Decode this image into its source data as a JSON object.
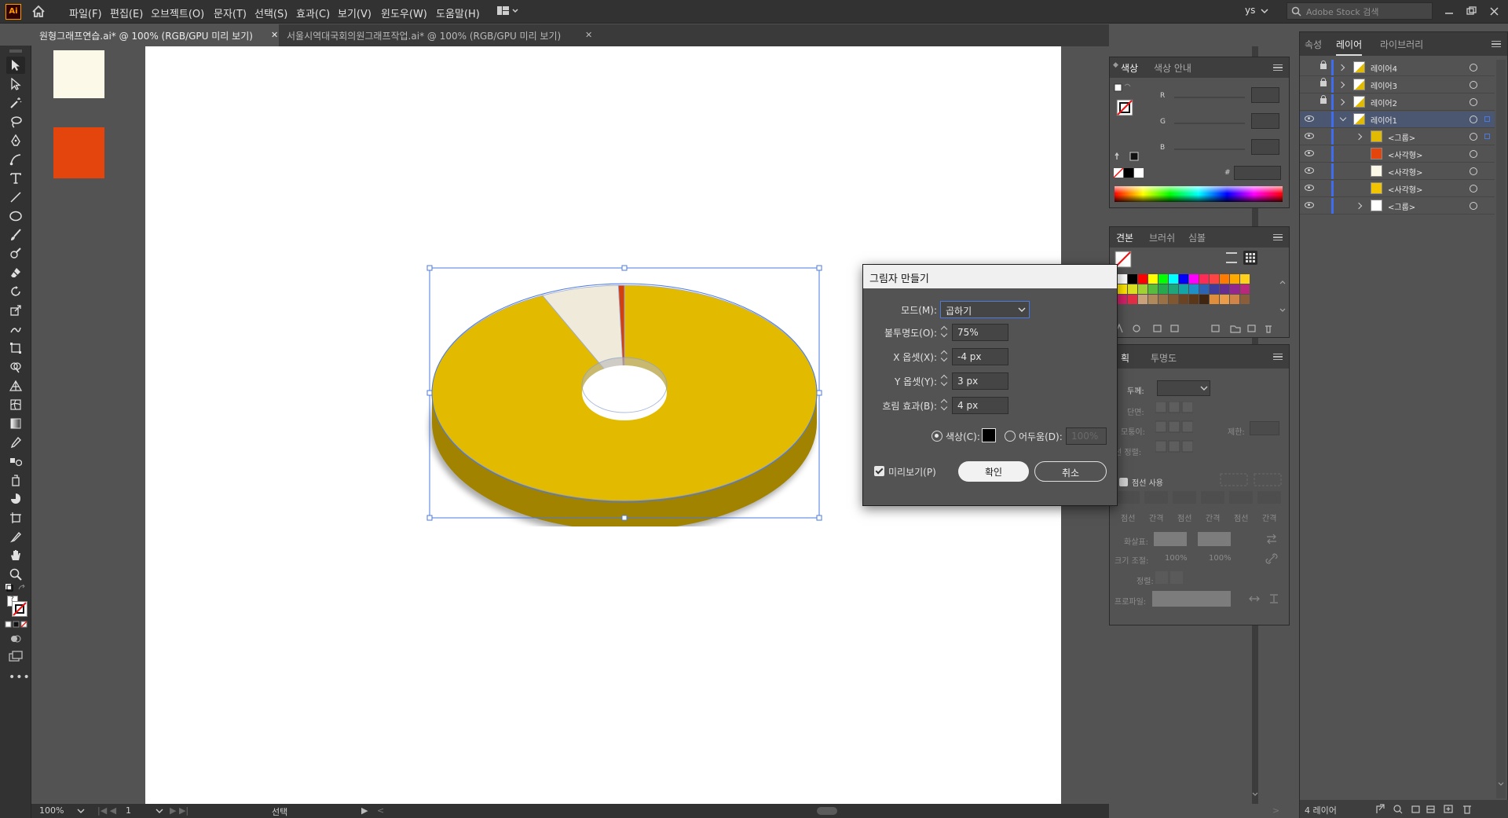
{
  "menu": {
    "logo": "Ai",
    "items": [
      "파일(F)",
      "편집(E)",
      "오브젝트(O)",
      "문자(T)",
      "선택(S)",
      "효과(C)",
      "보기(V)",
      "윈도우(W)",
      "도움말(H)"
    ],
    "user": "ys",
    "search_placeholder": "Adobe Stock 검색"
  },
  "tabs": [
    {
      "label": "원형그래프연습.ai* @ 100% (RGB/GPU 미리 보기)",
      "active": true
    },
    {
      "label": "서울시역대국회의원그래프작업.ai* @ 100% (RGB/GPU 미리 보기)",
      "active": false
    }
  ],
  "status": {
    "zoom": "100%",
    "page": "1",
    "tool": "선택"
  },
  "colors": {
    "donut_top": "#e2bb00",
    "donut_side": "#a28300",
    "slice_light": "#efead9",
    "slice_red": "#d2400f",
    "swatch_cream": "#fdf9e8",
    "swatch_orange": "#e3450c",
    "selection": "#4a7adf",
    "checkmark": "#ee3a14"
  },
  "chart_data": {
    "type": "pie",
    "values": [
      93,
      6.5,
      0.5
    ],
    "colors": [
      "#e2bb00",
      "#efead9",
      "#d2400f"
    ]
  },
  "color_panel": {
    "tabs": [
      "색상",
      "색상 안내"
    ],
    "labels": [
      "R",
      "G",
      "B"
    ],
    "hex_prefix": "#"
  },
  "swatches_panel": {
    "tabs": [
      "견본",
      "브러쉬",
      "심볼"
    ]
  },
  "stroke_panel": {
    "tabs": [
      "획",
      "투명도"
    ],
    "weight_label": "두께:",
    "cap_label": "단면:",
    "corner_label": "모퉁이:",
    "limit_label": "제한:",
    "align_label": "선 정렬:",
    "dashed_label": "점선 사용",
    "dash_labels": [
      "점선",
      "간격",
      "점선",
      "간격",
      "점선",
      "간격"
    ],
    "arrow_label": "화살표:",
    "scale_label": "크기 조절:",
    "scale_values": [
      "100%",
      "100%"
    ],
    "align2_label": "정렬:",
    "profile_label": "프로파일:"
  },
  "layers_panel": {
    "tabs": [
      "속성",
      "레이어",
      "라이브러리"
    ],
    "rows": [
      {
        "name": "레이어4",
        "visible": false,
        "locked": true,
        "expanded": false,
        "indent": 0,
        "selected": false
      },
      {
        "name": "레이어3",
        "visible": false,
        "locked": true,
        "expanded": false,
        "indent": 0,
        "selected": false
      },
      {
        "name": "레이어2",
        "visible": false,
        "locked": true,
        "expanded": false,
        "indent": 0,
        "selected": false
      },
      {
        "name": "레이어1",
        "visible": true,
        "locked": false,
        "expanded": true,
        "indent": 0,
        "selected": true
      },
      {
        "name": "<그룹>",
        "visible": true,
        "locked": false,
        "expanded": false,
        "indent": 1,
        "selected": false,
        "thumb": "#e2bb00"
      },
      {
        "name": "<사각형>",
        "visible": true,
        "locked": false,
        "indent": 1,
        "selected": false,
        "thumb": "#e3450c"
      },
      {
        "name": "<사각형>",
        "visible": true,
        "locked": false,
        "indent": 1,
        "selected": false,
        "thumb": "#fdf9e8"
      },
      {
        "name": "<사각형>",
        "visible": true,
        "locked": false,
        "indent": 1,
        "selected": false,
        "thumb": "#f2c400"
      },
      {
        "name": "<그룹>",
        "visible": true,
        "locked": false,
        "expanded": false,
        "indent": 1,
        "selected": false,
        "thumb": "#ffffff"
      }
    ],
    "footer": "4 레이어"
  },
  "dialog": {
    "title": "그림자 만들기",
    "mode_label": "모드(M):",
    "mode_value": "곱하기",
    "opacity_label": "불투명도(O):",
    "opacity_value": "75%",
    "x_label": "X 옵셋(X):",
    "x_value": "-4 px",
    "y_label": "Y 옵셋(Y):",
    "y_value": "3 px",
    "blur_label": "흐림 효과(B):",
    "blur_value": "4 px",
    "color_label": "색상(C):",
    "darkness_label": "어두움(D):",
    "darkness_value": "100%",
    "preview_label": "미리보기(P)",
    "ok_label": "확인",
    "cancel_label": "취소"
  }
}
